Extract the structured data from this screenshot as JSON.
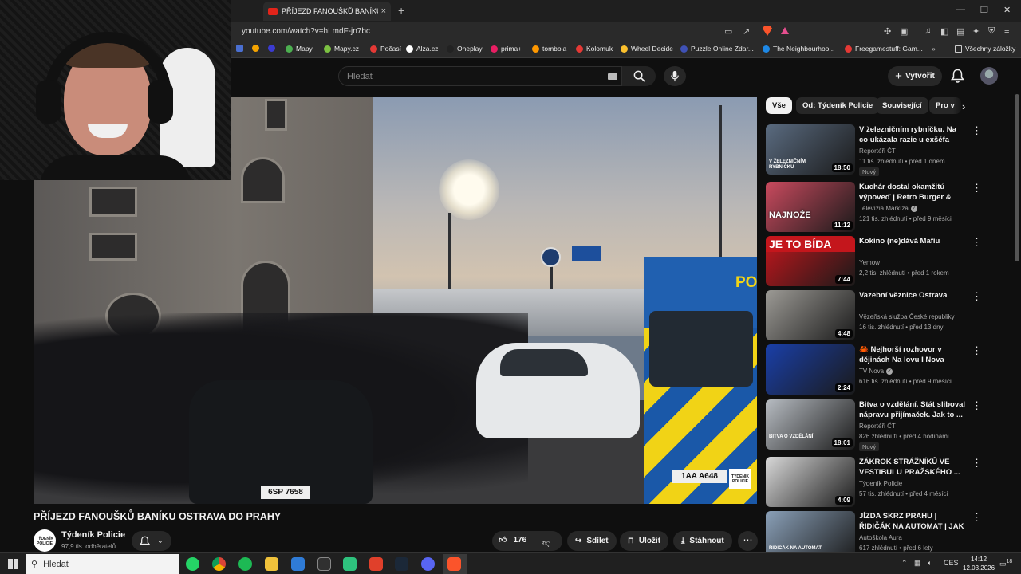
{
  "browser": {
    "tab_title": "PŘÍJEZD FANOUŠKŮ BANÍKU OSTRAVA DO PRAHY - YouTube",
    "tab_close": "×",
    "new_tab": "+",
    "window_controls": {
      "minimize": "—",
      "restore": "❐",
      "close": "✕"
    },
    "url": "youtube.com/watch?v=hLmdF-jn7bc",
    "bookmarks": [
      {
        "label": "Mapy",
        "color": "#4caf50"
      },
      {
        "label": "Mapy.cz",
        "color": "#7cc142"
      },
      {
        "label": "Počasí",
        "color": "#e53935"
      },
      {
        "label": "Alza.cz",
        "color": "#ffffff"
      },
      {
        "label": "Oneplay",
        "color": "#222222"
      },
      {
        "label": "prima+",
        "color": "#e91e63"
      },
      {
        "label": "tombola",
        "color": "#ff9800"
      },
      {
        "label": "Kolomuk",
        "color": "#e53935"
      },
      {
        "label": "Wheel Decide",
        "color": "#fbc02d"
      },
      {
        "label": "Puzzle Online Zdar...",
        "color": "#3f51b5"
      },
      {
        "label": "The Neighbourhoo...",
        "color": "#1e88e5"
      },
      {
        "label": "Freegamestuff: Gam...",
        "color": "#e53935"
      }
    ],
    "bookmarks_more": "»",
    "all_bookmarks": "Všechny záložky"
  },
  "header": {
    "search_placeholder": "Hledat",
    "create_label": "Vytvořit"
  },
  "video": {
    "title": "PŘÍJEZD FANOUŠKŮ BANÍKU OSTRAVA DO PRAHY",
    "channel": "Týdeník Policie",
    "channel_logo_text": "TÝDENÍK POLICIE",
    "subscribers": "97,9 tis. odběratelů",
    "likes": "176",
    "share_label": "Sdílet",
    "save_label": "Uložit",
    "download_label": "Stáhnout",
    "van_text": "PO",
    "plate_car": "6SP 7658",
    "plate_van": "1AA A648",
    "watermark": "TÝDENÍK POLICIE"
  },
  "chips": [
    {
      "label": "Vše",
      "active": true
    },
    {
      "label": "Od: Týdeník Policie",
      "active": false
    },
    {
      "label": "Související",
      "active": false
    },
    {
      "label": "Pro v",
      "active": false
    }
  ],
  "recommendations": [
    {
      "title": "V železničním rybníčku. Na co ukázala razie u exšéfa železni...",
      "channel": "Reportéři ČT",
      "meta": "11 tis. zhlédnutí • před 1 dnem",
      "duration": "18:50",
      "badge": "Nový",
      "thumb_text": "V ŽELEZNIČNÍM RYBNÍČKU",
      "verified": false
    },
    {
      "title": "Kuchár dostal okamžitú výpoveď | Retro Burger & Dinn...",
      "channel": "Televízia Markíza",
      "meta": "121 tis. zhlédnutí • před 9 měsíci",
      "duration": "11:12",
      "badge": "",
      "thumb_text": "NAJNOŽE",
      "verified": true
    },
    {
      "title": "Kokino (ne)dává Mafiu",
      "channel": "Yemow",
      "meta": "2,2 tis. zhlédnutí • před 1 rokem",
      "duration": "7:44",
      "badge": "",
      "thumb_text": "JE TO BÍDA",
      "verified": false
    },
    {
      "title": "Vazební věznice Ostrava",
      "channel": "Vězeňská služba České republiky",
      "meta": "16 tis. zhlédnutí • před 13 dny",
      "duration": "4:48",
      "badge": "",
      "thumb_text": "",
      "verified": false
    },
    {
      "title": "🦀 Nejhorší rozhovor v dějinách Na lovu I Nova",
      "channel": "TV Nova",
      "meta": "616 tis. zhlédnutí • před 9 měsíci",
      "duration": "2:24",
      "badge": "",
      "thumb_text": "",
      "verified": true
    },
    {
      "title": "Bitva o vzdělání. Stát sliboval nápravu přijímaček. Jak to ...",
      "channel": "Reportéři ČT",
      "meta": "826 zhlédnutí • před 4 hodinami",
      "duration": "18:01",
      "badge": "Nový",
      "thumb_text": "BITVA O VZDĚLÁNÍ",
      "verified": false
    },
    {
      "title": "ZÁKROK STRÁŽNÍKŮ VE VESTIBULU PRAŽSKÉHO ...",
      "channel": "Týdeník Policie",
      "meta": "57 tis. zhlédnutí • před 4 měsíci",
      "duration": "4:09",
      "badge": "",
      "thumb_text": "",
      "verified": false
    },
    {
      "title": "JÍZDA SKRZ PRAHU | ŘIDIČÁK NA AUTOMAT | JAK NA ...",
      "channel": "Autoškola Aura",
      "meta": "617 zhlédnutí • před 6 lety",
      "duration": "",
      "badge": "",
      "thumb_text": "ŘIDIČÁK NA AUTOMAT",
      "verified": false
    }
  ],
  "rec_colors": [
    "#5a6b80",
    "#c94a5e",
    "#c4161c",
    "#9c9a95",
    "#1a3fa8",
    "#b7bcc2",
    "#d8d8d8",
    "#8aa0b8"
  ],
  "taskbar": {
    "search_placeholder": "Hledat",
    "lang": "CES",
    "time": "14:12",
    "date": "12.03.2026",
    "notifications": "18"
  }
}
